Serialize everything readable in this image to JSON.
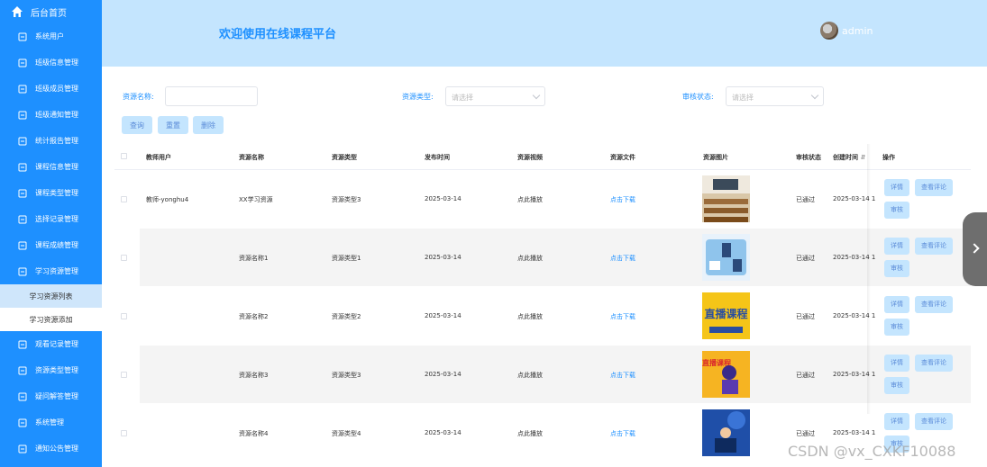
{
  "sidebar": {
    "home": "后台首页",
    "items": [
      "系统用户",
      "班级信息管理",
      "班级成员管理",
      "班级通知管理",
      "统计报告管理",
      "课程信息管理",
      "课程类型管理",
      "选择记录管理",
      "课程成绩管理",
      "学习资源管理"
    ],
    "sub_items": [
      "学习资源列表",
      "学习资源添加"
    ],
    "items_after": [
      "观看记录管理",
      "资源类型管理",
      "疑问解答管理",
      "系统管理",
      "通知公告管理"
    ]
  },
  "header": {
    "title": "欢迎使用在线课程平台",
    "username": "admin"
  },
  "filters": {
    "name_label": "资源名称:",
    "type_label": "资源类型:",
    "type_placeholder": "请选择",
    "audit_label": "审核状态:",
    "audit_placeholder": "请选择"
  },
  "actions": {
    "query": "查询",
    "reset": "重置",
    "delete": "删除"
  },
  "table": {
    "headers": [
      "教师用户",
      "资源名称",
      "资源类型",
      "发布时间",
      "资源视频",
      "资源文件",
      "资源图片",
      "审核状态",
      "创建时间",
      "操作"
    ],
    "rows": [
      {
        "teacher": "教师-yonghu4",
        "name": "XX学习资源",
        "type": "资源类型3",
        "date": "2025-03-14",
        "video": "点此播放",
        "file": "点击下载",
        "status": "已通过",
        "created": "2025-03-14 1"
      },
      {
        "teacher": "",
        "name": "资源名称1",
        "type": "资源类型1",
        "date": "2025-03-14",
        "video": "点此播放",
        "file": "点击下载",
        "status": "已通过",
        "created": "2025-03-14 1"
      },
      {
        "teacher": "",
        "name": "资源名称2",
        "type": "资源类型2",
        "date": "2025-03-14",
        "video": "点此播放",
        "file": "点击下载",
        "status": "已通过",
        "created": "2025-03-14 1"
      },
      {
        "teacher": "",
        "name": "资源名称3",
        "type": "资源类型3",
        "date": "2025-03-14",
        "video": "点此播放",
        "file": "点击下载",
        "status": "已通过",
        "created": "2025-03-14 1"
      },
      {
        "teacher": "",
        "name": "资源名称4",
        "type": "资源类型4",
        "date": "2025-03-14",
        "video": "点此播放",
        "file": "点击下载",
        "status": "已通过",
        "created": "2025-03-14 1"
      }
    ],
    "op_labels": {
      "detail": "详情",
      "comments": "查看评论",
      "audit": "审核"
    },
    "thumb_texts": {
      "live": "直播课程",
      "live2": "直播课程"
    }
  },
  "colors": {
    "sidebar": "#1e90ff",
    "header_bg": "#c4e5fe",
    "accent": "#1e90ff",
    "button_bg": "#c4e5fe"
  },
  "watermark": "CSDN @vx_CXKF10088"
}
